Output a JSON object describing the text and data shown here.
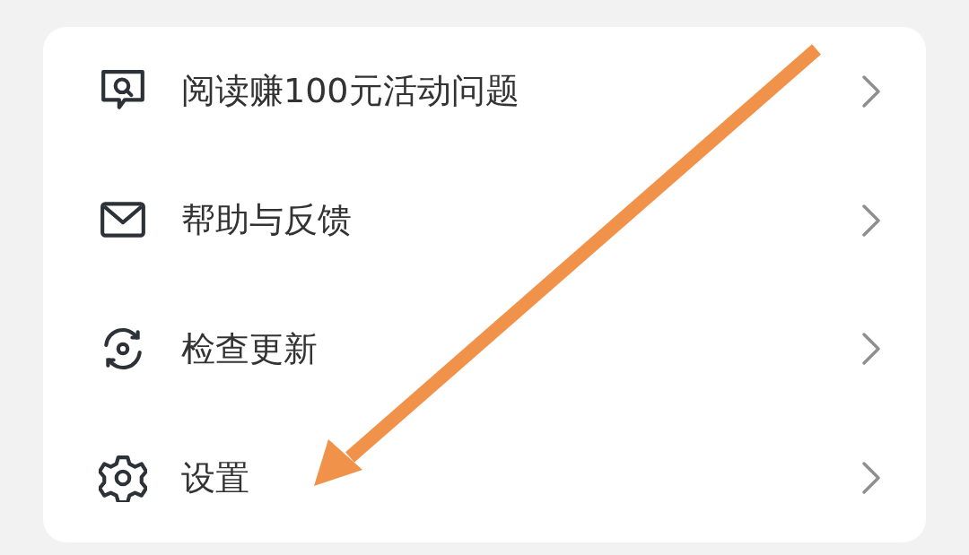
{
  "menu": [
    {
      "label": "阅读赚100元活动问题"
    },
    {
      "label": "帮助与反馈"
    },
    {
      "label": "检查更新"
    },
    {
      "label": "设置"
    }
  ]
}
